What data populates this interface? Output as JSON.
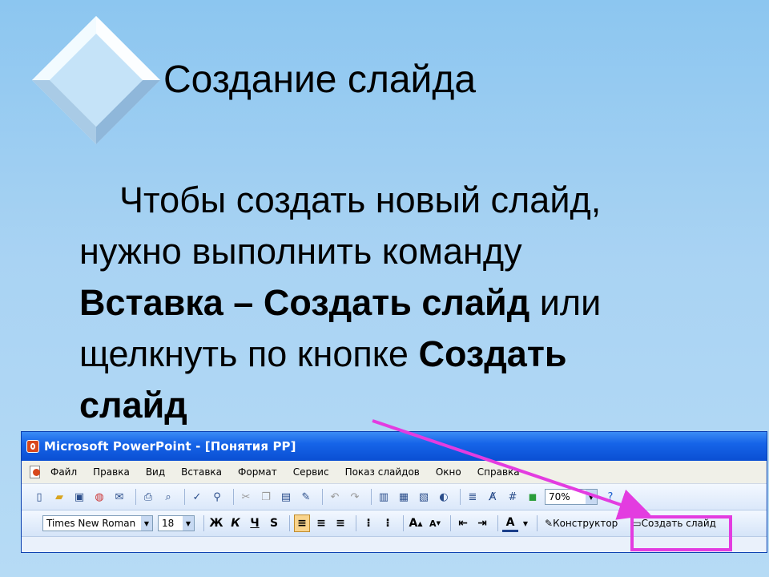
{
  "slide": {
    "title": "Создание слайда",
    "body": {
      "line1": "Чтобы создать новый слайд,",
      "line2": "нужно выполнить команду",
      "cmd_bold": "Вставка – Создать слайд",
      "or": " или",
      "line4": "щелкнуть по кнопке ",
      "button_bold_1": "Создать",
      "button_bold_2": "слайд"
    }
  },
  "window": {
    "title": "Microsoft PowerPoint - [Понятия PP]",
    "menu": [
      "Файл",
      "Правка",
      "Вид",
      "Вставка",
      "Формат",
      "Сервис",
      "Показ слайдов",
      "Окно",
      "Справка"
    ],
    "zoom": "70%",
    "font_name": "Times New Roman",
    "font_size": "18",
    "format_buttons": [
      "Ж",
      "К",
      "Ч",
      "S"
    ],
    "designer_label": "Конструктор",
    "new_slide_label": "Создать слайд"
  },
  "colors": {
    "highlight": "#e33ce0",
    "titlebar": "#0a4fd3"
  }
}
